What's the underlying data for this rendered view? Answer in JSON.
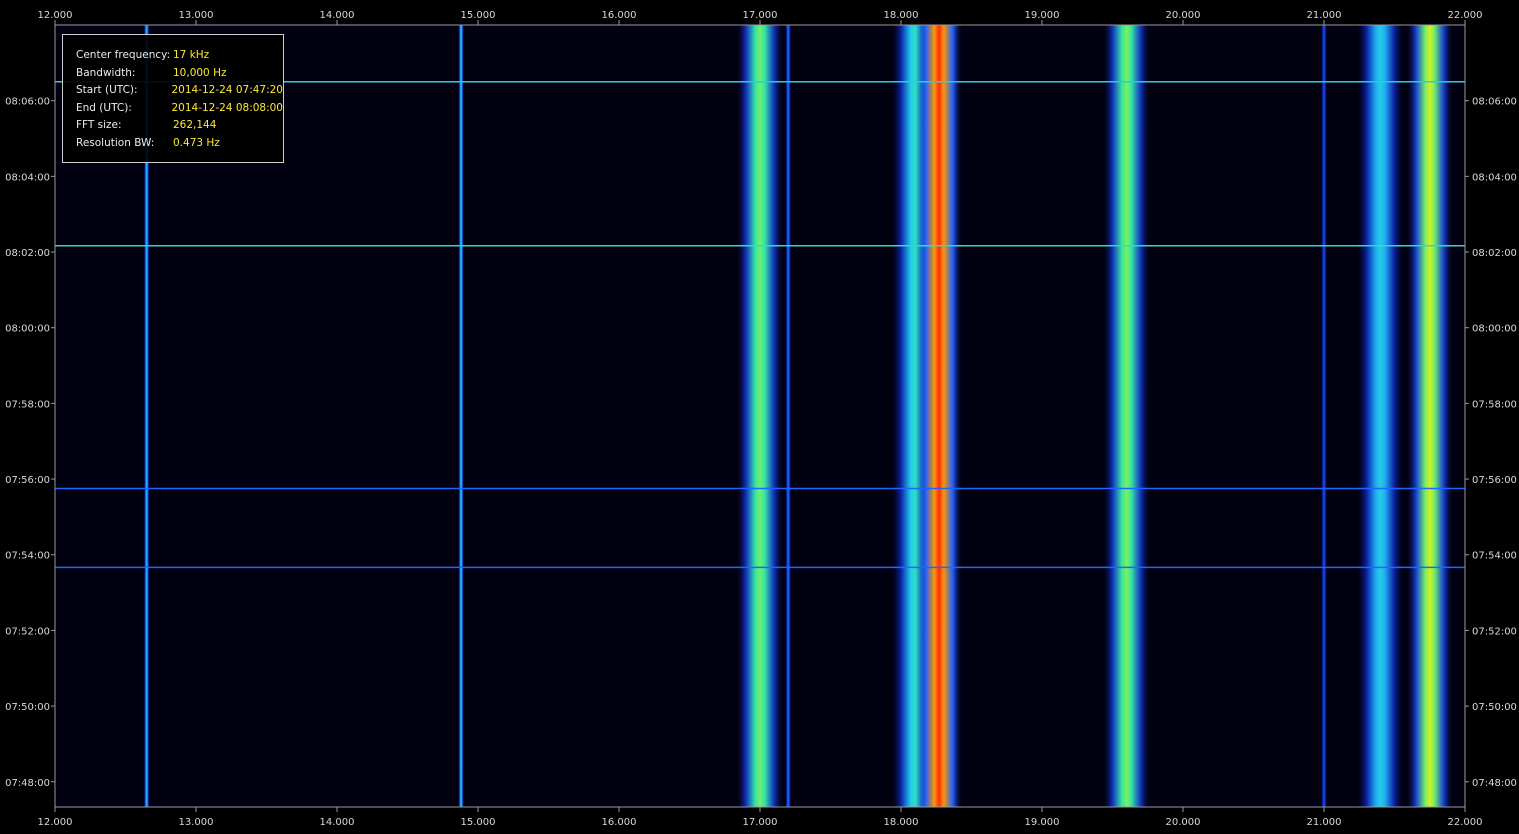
{
  "info": {
    "rows": [
      {
        "label": "Center frequency:",
        "value": "17 kHz"
      },
      {
        "label": "Bandwidth:",
        "value": "10,000 Hz"
      },
      {
        "label": "Start (UTC):",
        "value": "2014-12-24 07:47:20"
      },
      {
        "label": "End (UTC):",
        "value": "2014-12-24 08:08:00"
      },
      {
        "label": "FFT size:",
        "value": "262,144"
      },
      {
        "label": "Resolution BW:",
        "value": "0.473 Hz"
      }
    ]
  },
  "chart_data": {
    "type": "heatmap",
    "title": "",
    "xlabel": "",
    "ylabel": "",
    "xlim": [
      12.0,
      22.0
    ],
    "ylim": [
      "07:47:20",
      "08:08:00"
    ],
    "x_ticks": [
      "12.000",
      "13.000",
      "14.000",
      "15.000",
      "16.000",
      "17.000",
      "18.000",
      "19.000",
      "20.000",
      "21.000",
      "22.000"
    ],
    "y_ticks": [
      "08:06:00",
      "08:04:00",
      "08:02:00",
      "08:00:00",
      "07:58:00",
      "07:56:00",
      "07:54:00",
      "07:52:00",
      "07:50:00",
      "07:48:00"
    ],
    "grid": false,
    "colormap": [
      "#000010",
      "#0a1a9a",
      "#1e5cff",
      "#21c8f0",
      "#3cf08c",
      "#d8f020",
      "#ff8c00",
      "#ff1a1a"
    ],
    "colors": {
      "background": "#000000",
      "axis": "#9a9a9a",
      "label_text": "#ececec",
      "value_text": "#ffe832"
    },
    "signals": [
      {
        "freq_khz": 12.65,
        "level": 0.42,
        "kind": "narrow"
      },
      {
        "freq_khz": 14.88,
        "level": 0.44,
        "kind": "narrow"
      },
      {
        "freq_khz": 17.0,
        "level": 0.62,
        "kind": "band"
      },
      {
        "freq_khz": 17.2,
        "level": 0.3,
        "kind": "narrow"
      },
      {
        "freq_khz": 18.1,
        "level": 0.5,
        "kind": "band"
      },
      {
        "freq_khz": 18.27,
        "level": 0.98,
        "kind": "band"
      },
      {
        "freq_khz": 19.6,
        "level": 0.63,
        "kind": "band"
      },
      {
        "freq_khz": 21.0,
        "level": 0.25,
        "kind": "narrow"
      },
      {
        "freq_khz": 21.4,
        "level": 0.45,
        "kind": "band"
      },
      {
        "freq_khz": 21.75,
        "level": 0.72,
        "kind": "band"
      }
    ],
    "horizontal_lines": [
      {
        "time": "08:06:30",
        "level": 0.45
      },
      {
        "time": "08:02:10",
        "level": 0.5
      },
      {
        "time": "07:55:45",
        "level": 0.3
      },
      {
        "time": "07:53:40",
        "level": 0.3
      }
    ]
  }
}
